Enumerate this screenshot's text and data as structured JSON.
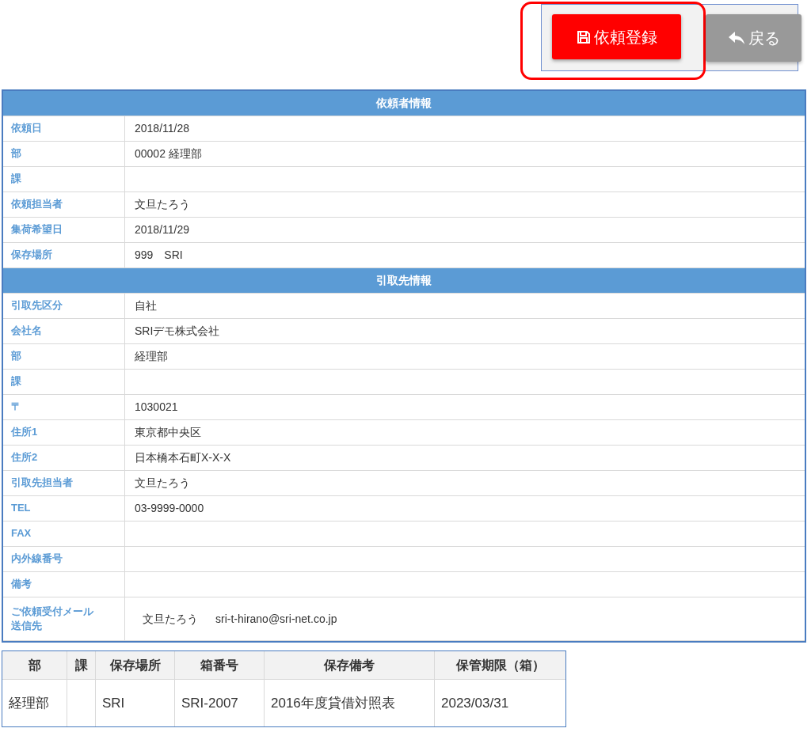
{
  "toolbar": {
    "buttons": [
      {
        "kind": "save",
        "label": "依頼登録",
        "highlighted": true
      },
      {
        "kind": "back",
        "label": "戻る",
        "highlighted": false
      }
    ]
  },
  "sections": [
    {
      "title": "依頼者情報",
      "rows": [
        {
          "label": "依頼日",
          "values": [
            "2018/11/28"
          ]
        },
        {
          "label": "部",
          "values": [
            "00002 経理部"
          ]
        },
        {
          "label": "課",
          "values": []
        },
        {
          "label": "依頼担当者",
          "values": [
            "文旦たろう"
          ]
        },
        {
          "label": "集荷希望日",
          "values": [
            "2018/11/29"
          ]
        },
        {
          "label": "保存場所",
          "values": [
            "999　SRI"
          ]
        }
      ]
    },
    {
      "title": "引取先情報",
      "rows": [
        {
          "label": "引取先区分",
          "values": [
            "自社"
          ]
        },
        {
          "label": "会社名",
          "values": [
            "SRIデモ株式会社"
          ]
        },
        {
          "label": "部",
          "values": [
            "経理部"
          ]
        },
        {
          "label": "課",
          "values": []
        },
        {
          "label": "〒",
          "values": [
            "1030021"
          ]
        },
        {
          "label": "住所1",
          "values": [
            "東京都中央区"
          ]
        },
        {
          "label": "住所2",
          "values": [
            "日本橋本石町X-X-X"
          ]
        },
        {
          "label": "引取先担当者",
          "values": [
            "文旦たろう"
          ]
        },
        {
          "label": "TEL",
          "values": [
            "03-9999-0000"
          ]
        },
        {
          "label": "FAX",
          "values": []
        },
        {
          "label": "内外線番号",
          "values": []
        },
        {
          "label": "備考",
          "values": []
        },
        {
          "label": "ご依頼受付メール送信先",
          "values": [
            "文旦たろう",
            "sri-t-hirano@sri-net.co.jp"
          ]
        }
      ]
    }
  ],
  "boxes": {
    "columns": [
      "部",
      "課",
      "保存場所",
      "箱番号",
      "保存備考",
      "保管期限（箱）"
    ],
    "rows": [
      [
        "経理部",
        "",
        "SRI",
        "SRI-2007",
        "2016年度貸借対照表",
        "2023/03/31"
      ]
    ]
  }
}
